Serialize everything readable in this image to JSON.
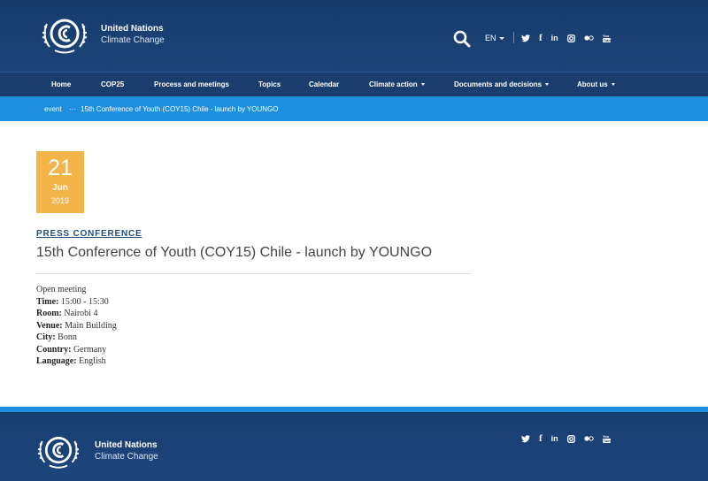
{
  "brand": {
    "line1": "United Nations",
    "line2": "Climate Change"
  },
  "header": {
    "language": "EN",
    "socials": [
      {
        "name": "twitter",
        "glyph": "⭛"
      },
      {
        "name": "facebook",
        "glyph": "f"
      },
      {
        "name": "linkedin",
        "glyph": "in"
      },
      {
        "name": "instagram",
        "glyph": "▣"
      },
      {
        "name": "flickr",
        "glyph": "●○"
      },
      {
        "name": "youtube",
        "glyph": "You"
      }
    ]
  },
  "nav": {
    "items": [
      {
        "label": "Home",
        "dropdown": false
      },
      {
        "label": "COP25",
        "dropdown": false
      },
      {
        "label": "Process and meetings",
        "dropdown": false
      },
      {
        "label": "Topics",
        "dropdown": false
      },
      {
        "label": "Calendar",
        "dropdown": false
      },
      {
        "label": "Climate action",
        "dropdown": true
      },
      {
        "label": "Documents and decisions",
        "dropdown": true
      },
      {
        "label": "About us",
        "dropdown": true
      }
    ]
  },
  "breadcrumb": {
    "section": "event",
    "separator": "···",
    "current": "15th Conference of Youth (COY15) Chile - launch by YOUNGO"
  },
  "event": {
    "date": {
      "day": "21",
      "month": "Jun",
      "year": "2019"
    },
    "type": "PRESS CONFERENCE",
    "title": "15th Conference of Youth (COY15) Chile - launch by YOUNGO",
    "access": "Open meeting",
    "details": [
      {
        "label": "Time:",
        "value": "15:00 - 15:30"
      },
      {
        "label": "Room:",
        "value": "Nairobi 4"
      },
      {
        "label": "Venue:",
        "value": "Main Building"
      },
      {
        "label": "City:",
        "value": "Bonn"
      },
      {
        "label": "Country:",
        "value": "Germany"
      },
      {
        "label": "Language:",
        "value": "English"
      }
    ]
  },
  "footer": {
    "line1": "United Nations",
    "line2": "Climate Change"
  },
  "colors": {
    "header_bg": "#173a6b",
    "nav_bg": "#1b3d6d",
    "breadcrumb_bg": "#1e8ede",
    "date_box": "#f3b549",
    "link": "#1f4e7a"
  }
}
